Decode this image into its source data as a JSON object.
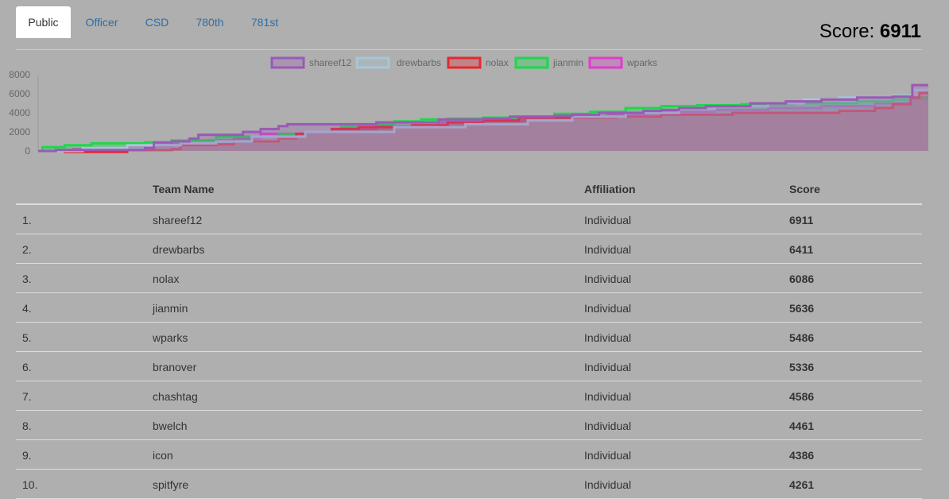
{
  "tabs": [
    {
      "label": "Public",
      "active": true
    },
    {
      "label": "Officer",
      "active": false
    },
    {
      "label": "CSD",
      "active": false
    },
    {
      "label": "780th",
      "active": false
    },
    {
      "label": "781st",
      "active": false
    }
  ],
  "score": {
    "label": "Score: ",
    "value": "6911"
  },
  "chart_data": {
    "type": "line",
    "ylim": [
      0,
      8000
    ],
    "yticks": [
      "8000",
      "6000",
      "4000",
      "2000",
      "0"
    ],
    "series": [
      {
        "name": "shareef12",
        "color": "#9b59b6",
        "fill": "rgba(155,89,182,0.30)",
        "final": 6911,
        "points": [
          [
            0,
            0
          ],
          [
            0.02,
            100
          ],
          [
            0.12,
            300
          ],
          [
            0.13,
            900
          ],
          [
            0.15,
            1000
          ],
          [
            0.17,
            1300
          ],
          [
            0.18,
            1700
          ],
          [
            0.23,
            2000
          ],
          [
            0.25,
            2300
          ],
          [
            0.27,
            2600
          ],
          [
            0.28,
            2800
          ],
          [
            0.38,
            3000
          ],
          [
            0.45,
            3300
          ],
          [
            0.5,
            3400
          ],
          [
            0.53,
            3600
          ],
          [
            0.58,
            3700
          ],
          [
            0.6,
            3800
          ],
          [
            0.63,
            4000
          ],
          [
            0.68,
            4200
          ],
          [
            0.7,
            4300
          ],
          [
            0.72,
            4500
          ],
          [
            0.75,
            4700
          ],
          [
            0.8,
            5000
          ],
          [
            0.84,
            5200
          ],
          [
            0.88,
            5400
          ],
          [
            0.92,
            5600
          ],
          [
            0.96,
            5700
          ],
          [
            0.982,
            6911
          ],
          [
            1.0,
            6911
          ]
        ]
      },
      {
        "name": "drewbarbs",
        "color": "#a8c6d8",
        "fill": "rgba(168,198,216,0.30)",
        "final": 6411,
        "points": [
          [
            0,
            0
          ],
          [
            0.05,
            300
          ],
          [
            0.1,
            600
          ],
          [
            0.16,
            800
          ],
          [
            0.2,
            1000
          ],
          [
            0.24,
            1500
          ],
          [
            0.3,
            2000
          ],
          [
            0.4,
            2500
          ],
          [
            0.48,
            2800
          ],
          [
            0.55,
            3200
          ],
          [
            0.6,
            3600
          ],
          [
            0.66,
            4000
          ],
          [
            0.72,
            4400
          ],
          [
            0.76,
            4700
          ],
          [
            0.82,
            5000
          ],
          [
            0.86,
            5400
          ],
          [
            0.9,
            5600
          ],
          [
            0.96,
            5800
          ],
          [
            0.982,
            6411
          ],
          [
            1.0,
            6411
          ]
        ]
      },
      {
        "name": "nolax",
        "color": "#e8262e",
        "fill": "rgba(232,38,46,0.30)",
        "final": 6086,
        "points": [
          [
            0,
            0
          ],
          [
            0.03,
            -100
          ],
          [
            0.1,
            100
          ],
          [
            0.15,
            200
          ],
          [
            0.16,
            600
          ],
          [
            0.2,
            700
          ],
          [
            0.22,
            1000
          ],
          [
            0.27,
            1300
          ],
          [
            0.29,
            1800
          ],
          [
            0.3,
            2000
          ],
          [
            0.33,
            2300
          ],
          [
            0.36,
            2500
          ],
          [
            0.42,
            2700
          ],
          [
            0.46,
            3000
          ],
          [
            0.5,
            3200
          ],
          [
            0.54,
            3500
          ],
          [
            0.62,
            3500
          ],
          [
            0.65,
            3600
          ],
          [
            0.7,
            3800
          ],
          [
            0.78,
            4000
          ],
          [
            0.9,
            4200
          ],
          [
            0.94,
            4500
          ],
          [
            0.96,
            4900
          ],
          [
            0.98,
            5600
          ],
          [
            0.99,
            6086
          ],
          [
            1.0,
            6086
          ]
        ]
      },
      {
        "name": "jianmin",
        "color": "#1cd84c",
        "fill": "rgba(28,216,76,0.30)",
        "final": 5636,
        "points": [
          [
            0,
            0
          ],
          [
            0.005,
            400
          ],
          [
            0.03,
            600
          ],
          [
            0.06,
            800
          ],
          [
            0.12,
            900
          ],
          [
            0.15,
            1100
          ],
          [
            0.2,
            1500
          ],
          [
            0.27,
            1800
          ],
          [
            0.3,
            2000
          ],
          [
            0.34,
            2500
          ],
          [
            0.38,
            2800
          ],
          [
            0.4,
            3100
          ],
          [
            0.43,
            3300
          ],
          [
            0.46,
            3400
          ],
          [
            0.5,
            3500
          ],
          [
            0.54,
            3600
          ],
          [
            0.58,
            3900
          ],
          [
            0.62,
            4100
          ],
          [
            0.66,
            4500
          ],
          [
            0.7,
            4700
          ],
          [
            0.74,
            4800
          ],
          [
            0.79,
            4900
          ],
          [
            0.85,
            5000
          ],
          [
            0.92,
            5200
          ],
          [
            0.96,
            5400
          ],
          [
            0.98,
            5636
          ],
          [
            1.0,
            5636
          ]
        ]
      },
      {
        "name": "wparks",
        "color": "#e23bd0",
        "fill": "rgba(226,59,208,0.30)",
        "final": 5486,
        "points": [
          [
            0,
            0
          ],
          [
            0.04,
            200
          ],
          [
            0.1,
            500
          ],
          [
            0.15,
            700
          ],
          [
            0.2,
            1100
          ],
          [
            0.22,
            1300
          ],
          [
            0.25,
            1800
          ],
          [
            0.3,
            2000
          ],
          [
            0.34,
            2300
          ],
          [
            0.38,
            2600
          ],
          [
            0.45,
            3000
          ],
          [
            0.5,
            3200
          ],
          [
            0.55,
            3500
          ],
          [
            0.6,
            3600
          ],
          [
            0.64,
            3900
          ],
          [
            0.7,
            4100
          ],
          [
            0.76,
            4300
          ],
          [
            0.82,
            4500
          ],
          [
            0.88,
            4700
          ],
          [
            0.94,
            5000
          ],
          [
            0.98,
            5486
          ],
          [
            1.0,
            5486
          ]
        ]
      }
    ]
  },
  "table": {
    "headers": {
      "name": "Team Name",
      "affiliation": "Affiliation",
      "score": "Score"
    },
    "rows": [
      {
        "rank": "1.",
        "name": "shareef12",
        "affiliation": "Individual",
        "score": "6911"
      },
      {
        "rank": "2.",
        "name": "drewbarbs",
        "affiliation": "Individual",
        "score": "6411"
      },
      {
        "rank": "3.",
        "name": "nolax",
        "affiliation": "Individual",
        "score": "6086"
      },
      {
        "rank": "4.",
        "name": "jianmin",
        "affiliation": "Individual",
        "score": "5636"
      },
      {
        "rank": "5.",
        "name": "wparks",
        "affiliation": "Individual",
        "score": "5486"
      },
      {
        "rank": "6.",
        "name": "branover",
        "affiliation": "Individual",
        "score": "5336"
      },
      {
        "rank": "7.",
        "name": "chashtag",
        "affiliation": "Individual",
        "score": "4586"
      },
      {
        "rank": "8.",
        "name": "bwelch",
        "affiliation": "Individual",
        "score": "4461"
      },
      {
        "rank": "9.",
        "name": "icon",
        "affiliation": "Individual",
        "score": "4386"
      },
      {
        "rank": "10.",
        "name": "spitfyre",
        "affiliation": "Individual",
        "score": "4261"
      }
    ]
  }
}
